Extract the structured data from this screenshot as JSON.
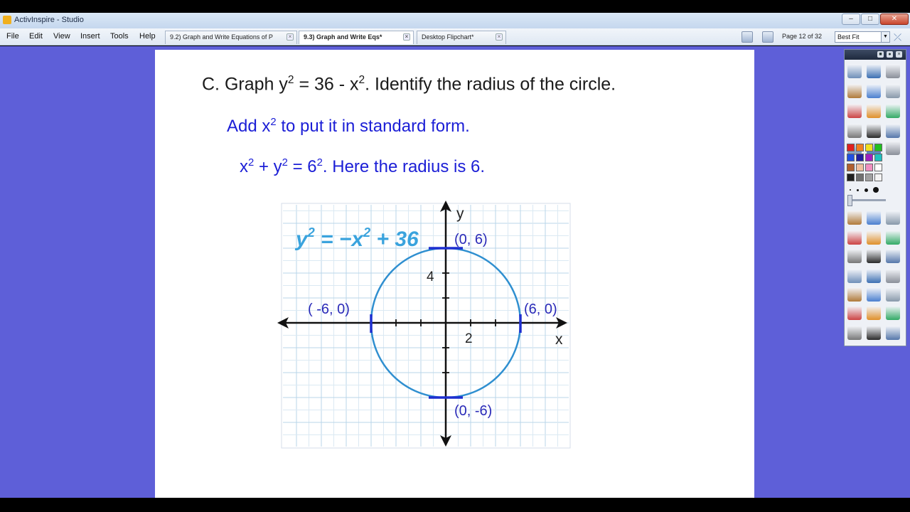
{
  "window": {
    "title": "ActivInspire - Studio"
  },
  "menu": {
    "items": [
      "File",
      "Edit",
      "View",
      "Insert",
      "Tools",
      "Help"
    ]
  },
  "tabs": [
    {
      "label": "9.2) Graph and Write Equations of P",
      "active": false
    },
    {
      "label": "9.3) Graph and Write Eqs*",
      "active": true
    },
    {
      "label": "Desktop Flipchart*",
      "active": false
    }
  ],
  "toolbar": {
    "page_indicator": "Page 12 of 32",
    "zoom_value": "Best Fit"
  },
  "flipchart": {
    "question_prefix": "C. Graph y",
    "question_mid": " = 36 - x",
    "question_suffix": ".  Identify the radius of the circle.",
    "exp2": "2",
    "answer_line1_a": "Add x",
    "answer_line1_b": " to put it in standard form.",
    "answer_line2_a": "x",
    "answer_line2_b": " + y",
    "answer_line2_c": " = 6",
    "answer_line2_d": ".  Here the radius is 6."
  },
  "graph": {
    "equation_lhs": "y",
    "equation_rhs": " = −x",
    "equation_const": " + 36",
    "x_axis_label": "x",
    "y_axis_label": "y",
    "tick_label_x": "2",
    "tick_label_y": "4",
    "point_top": "(0, 6)",
    "point_left": "( -6,  0)",
    "point_right": "(6, 0)",
    "point_bottom": "(0,  -6)",
    "radius": 6,
    "curve_color": "#2f8fd0",
    "equation_color": "#3aa3dd",
    "label_color": "#2a2ab8"
  },
  "colors": {
    "workspace": "#5e5fd8",
    "question_text": "#1a1a1a",
    "answer_text": "#1b1ed6"
  }
}
